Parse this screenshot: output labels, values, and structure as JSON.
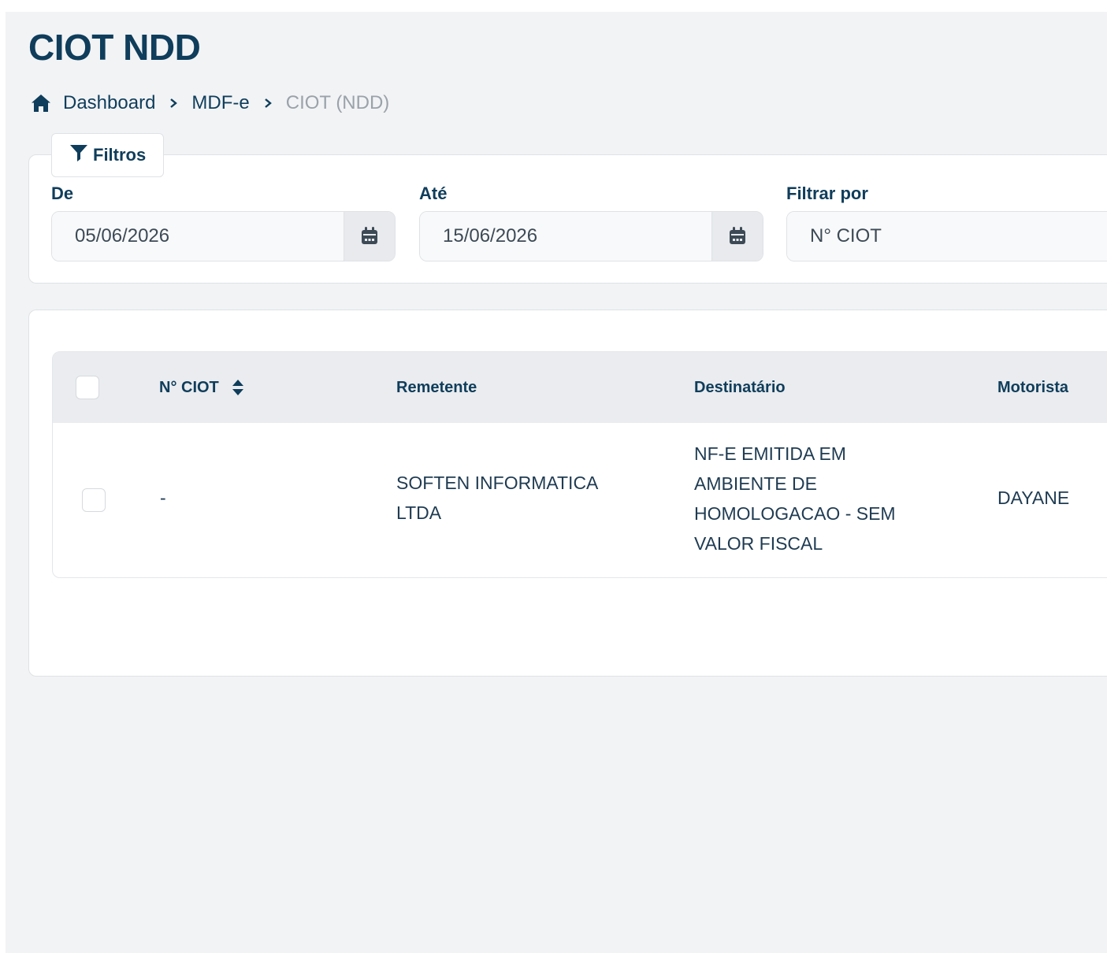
{
  "page": {
    "title": "CIOT NDD"
  },
  "breadcrumb": {
    "items": [
      "Dashboard",
      "MDF-e"
    ],
    "current": "CIOT (NDD)"
  },
  "filters": {
    "tab_label": "Filtros",
    "from": {
      "label": "De",
      "value": "05/06/2026"
    },
    "to": {
      "label": "Até",
      "value": "15/06/2026"
    },
    "filter_by": {
      "label": "Filtrar por",
      "value": "N° CIOT"
    }
  },
  "table": {
    "columns": [
      "N° CIOT",
      "Remetente",
      "Destinatário",
      "Motorista"
    ],
    "rows": [
      {
        "ciot": "-",
        "remetente": [
          "SOFTEN INFORMATICA",
          "LTDA"
        ],
        "destinatario": [
          "NF-E EMITIDA EM",
          "AMBIENTE DE",
          "HOMOLOGACAO - SEM",
          "VALOR FISCAL"
        ],
        "motorista": "DAYANE"
      }
    ]
  },
  "colors": {
    "primary_text": "#0f3d5b",
    "muted": "#9aa2aa",
    "background": "#f2f3f5"
  },
  "icons": {
    "home": "home-icon",
    "filter": "filter-icon",
    "calendar": "calendar-icon",
    "sort": "sort-icon",
    "chevron": "chevron-right-icon"
  }
}
